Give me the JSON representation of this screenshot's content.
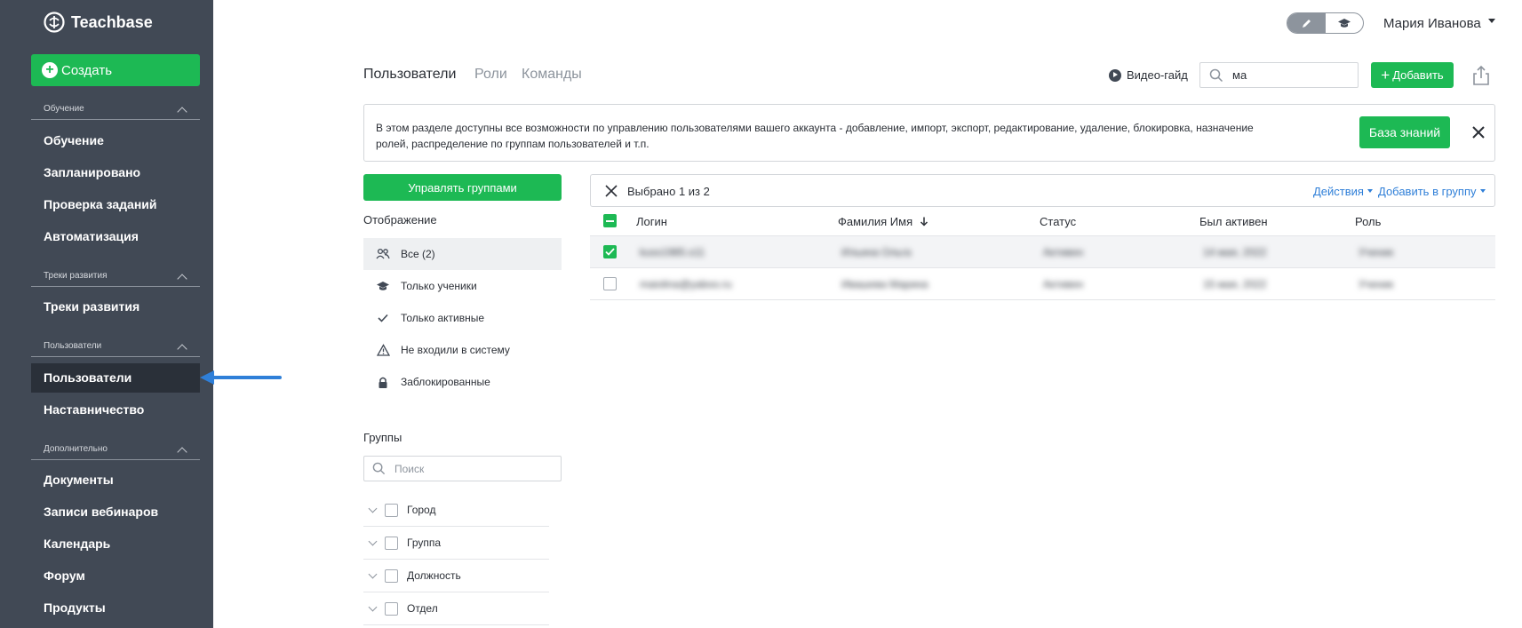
{
  "sidebar": {
    "logo_text": "Teachbase",
    "create_label": "Создать",
    "sections": [
      {
        "title": "Обучение",
        "items": [
          "Обучение",
          "Запланировано",
          "Проверка заданий",
          "Автоматизация"
        ]
      },
      {
        "title": "Треки развития",
        "items": [
          "Треки развития"
        ]
      },
      {
        "title": "Пользователи",
        "items": [
          "Пользователи",
          "Наставничество"
        ]
      },
      {
        "title": "Дополнительно",
        "items": [
          "Документы",
          "Записи вебинаров",
          "Календарь",
          "Форум",
          "Продукты"
        ]
      }
    ],
    "active_item": "Пользователи"
  },
  "header": {
    "user_name": "Мария Иванова",
    "mode": "edit"
  },
  "tabs": [
    "Пользователи",
    "Роли",
    "Команды"
  ],
  "active_tab": "Пользователи",
  "toolbar": {
    "video_guide_label": "Видео-гайд",
    "search_value": "ма",
    "add_label": "Добавить"
  },
  "banner": {
    "text": "В этом разделе доступны все возможности по управлению пользователями вашего аккаунта - добавление, импорт, экспорт, редактирование, удаление, блокировка, назначение ролей, распределение по группам пользователей и т.п.",
    "kb_label": "База знаний"
  },
  "filters": {
    "manage_groups_label": "Управлять группами",
    "display_title": "Отображение",
    "items": [
      {
        "label": "Все (2)",
        "icon": "users-icon",
        "active": true
      },
      {
        "label": "Только ученики",
        "icon": "graduation-cap-icon",
        "active": false
      },
      {
        "label": "Только активные",
        "icon": "check-icon",
        "active": false
      },
      {
        "label": "Не входили в систему",
        "icon": "warning-icon",
        "active": false
      },
      {
        "label": "Заблокированные",
        "icon": "lock-icon",
        "active": false
      }
    ],
    "groups_title": "Группы",
    "groups_search_placeholder": "Поиск",
    "groups": [
      "Город",
      "Группа",
      "Должность",
      "Отдел"
    ]
  },
  "selection": {
    "text": "Выбрано 1 из 2",
    "actions_label": "Действия",
    "add_to_group_label": "Добавить в группу"
  },
  "table": {
    "columns": [
      "Логин",
      "Фамилия Имя",
      "Статус",
      "Был активен",
      "Роль"
    ],
    "sort_column": "Фамилия Имя",
    "rows": [
      {
        "selected": true,
        "cells": [
          "kuss1985.s11",
          "Ильина Ольга",
          "Активен",
          "14 мая, 2022",
          "Ученик"
        ]
      },
      {
        "selected": false,
        "cells": [
          "maiolina@yaboo.ru",
          "Ивашева Марина",
          "Активен",
          "15 мая, 2022",
          "Ученик"
        ]
      }
    ]
  },
  "colors": {
    "sidebar_bg": "#414955",
    "accent_green": "#1db954",
    "link_blue": "#2f7fd8"
  }
}
